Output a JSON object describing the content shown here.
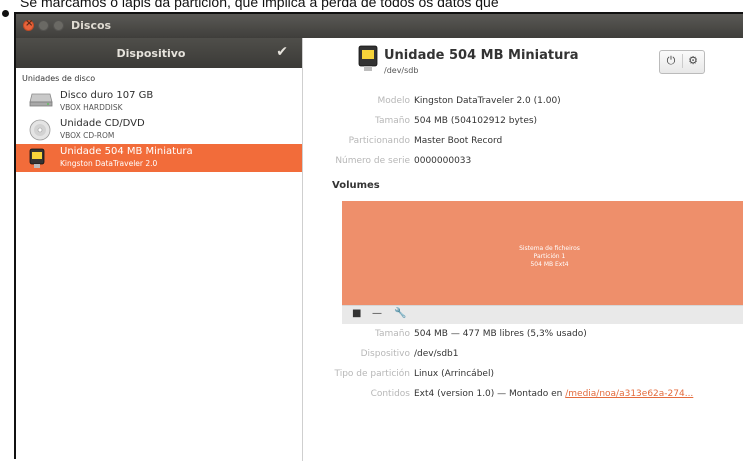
{
  "page": {
    "top_text": "Se marcamos o lápis da partición, que implica a perda de todos os datos que"
  },
  "window": {
    "title": "Discos"
  },
  "sidebar": {
    "header": "Dispositivo",
    "section_label": "Unidades de disco",
    "devices": [
      {
        "name": "Disco duro 107 GB",
        "sub": "VBOX HARDDISK",
        "icon": "hard-disk-icon"
      },
      {
        "name": "Unidade CD/DVD",
        "sub": "VBOX CD-ROM",
        "icon": "optical-drive-icon"
      },
      {
        "name": "Unidade 504 MB Miniatura",
        "sub": "Kingston DataTraveler 2.0",
        "icon": "usb-drive-icon",
        "selected": true
      }
    ]
  },
  "drive": {
    "title": "Unidade 504 MB Miniatura",
    "path": "/dev/sdb",
    "fields": [
      {
        "label": "Modelo",
        "value": "Kingston DataTraveler 2.0 (1.00)"
      },
      {
        "label": "Tamaño",
        "value": "504 MB (504102912 bytes)"
      },
      {
        "label": "Particionando",
        "value": "Master Boot Record"
      },
      {
        "label": "Número de serie",
        "value": "0000000033"
      }
    ],
    "power_icon": "power-icon",
    "settings_icon": "gear-icon"
  },
  "volumes": {
    "title": "Volumes",
    "block_lines": [
      "Sistema de ficheiros",
      "Partición 1",
      "504 MB Ext4"
    ],
    "fields": [
      {
        "label": "Tamaño",
        "value": "504 MB — 477 MB libres (5,3% usado)"
      },
      {
        "label": "Dispositivo",
        "value": "/dev/sdb1"
      },
      {
        "label": "Tipo de partición",
        "value": "Linux (Arrincábel)"
      }
    ],
    "contents_label": "Contidos",
    "contents_text": "Ext4 (version 1.0) — Montado en",
    "contents_link": "/media/noa/a313e62a-274..."
  }
}
